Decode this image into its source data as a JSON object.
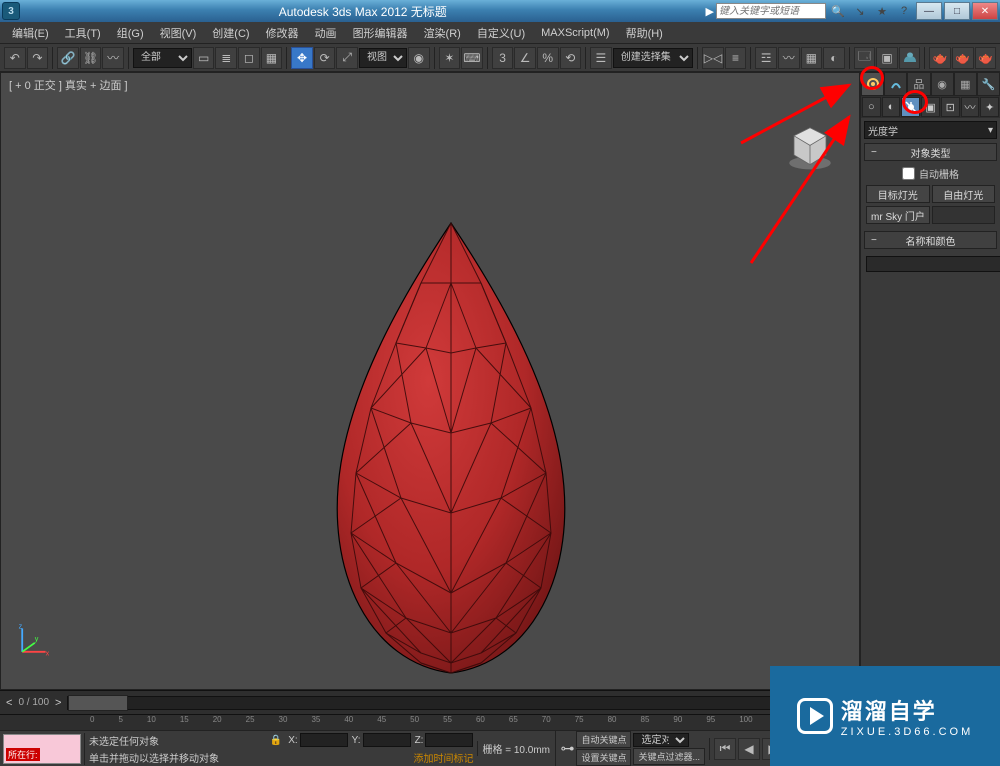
{
  "title": "Autodesk 3ds Max  2012      无标题",
  "search_placeholder": "键入关键字或短语",
  "menus": [
    "编辑(E)",
    "工具(T)",
    "组(G)",
    "视图(V)",
    "创建(C)",
    "修改器",
    "动画",
    "图形编辑器",
    "渲染(R)",
    "自定义(U)",
    "MAXScript(M)",
    "帮助(H)"
  ],
  "toolbar": {
    "scope_dropdown": "全部",
    "view_dropdown": "视图",
    "selection_set": "创建选择集"
  },
  "viewport": {
    "label": "[ + 0 正交 ] 真实 + 边面 ]"
  },
  "panel": {
    "dropdown": "光度学",
    "rollout1_title": "对象类型",
    "autogrid": "自动栅格",
    "btn_target_light": "目标灯光",
    "btn_free_light": "自由灯光",
    "btn_mr_sky": "mr Sky 门户",
    "rollout2_title": "名称和颜色"
  },
  "timeslider": {
    "frames": "0 / 100"
  },
  "ruler_ticks": [
    "0",
    "5",
    "10",
    "15",
    "20",
    "25",
    "30",
    "35",
    "40",
    "45",
    "50",
    "55",
    "60",
    "65",
    "70",
    "75",
    "80",
    "85",
    "90",
    "95",
    "100"
  ],
  "status": {
    "mini_label": "所在行:",
    "line1": "未选定任何对象",
    "line2": "单击并拖动以选择并移动对象",
    "x": "X:",
    "y": "Y:",
    "z": "Z:",
    "grid": "栅格 = 10.0mm",
    "addtime": "添加时间标记",
    "autokey": "自动关键点",
    "setkey": "设置关键点",
    "selfilter": "选定对象",
    "keyfilter": "关键点过滤器..."
  },
  "watermark": {
    "big": "溜溜自学",
    "small": "ZIXUE.3D66.COM"
  }
}
